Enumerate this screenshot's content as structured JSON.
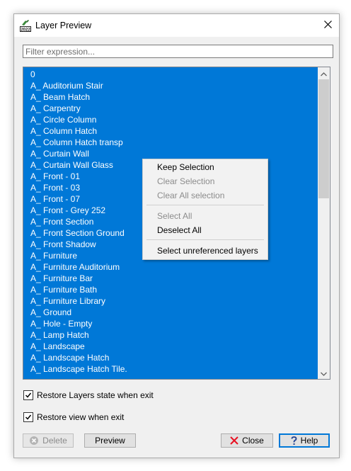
{
  "window": {
    "title": "Layer Preview"
  },
  "filter": {
    "placeholder": "Filter expression...",
    "value": ""
  },
  "layers": [
    "0",
    "A_ Auditorium Stair",
    "A_ Beam Hatch",
    "A_ Carpentry",
    "A_ Circle Column",
    "A_ Column Hatch",
    "A_ Column Hatch transp",
    "A_ Curtain Wall",
    "A_ Curtain Wall Glass",
    "A_ Front - 01",
    "A_ Front - 03",
    "A_ Front - 07",
    "A_ Front - Grey 252",
    "A_ Front Section",
    "A_ Front Section Ground",
    "A_ Front Shadow",
    "A_ Furniture",
    "A_ Furniture Auditorium",
    "A_ Furniture Bar",
    "A_ Furniture Bath",
    "A_ Furniture Library",
    "A_ Ground",
    "A_ Hole - Empty",
    "A_ Lamp Hatch",
    "A_ Landscape",
    "A_ Landscape Hatch",
    "A_ Landscape Hatch Tile."
  ],
  "context_menu": {
    "keep_selection": "Keep Selection",
    "clear_selection": "Clear Selection",
    "clear_all_selection": "Clear All selection",
    "select_all": "Select All",
    "deselect_all": "Deselect All",
    "select_unreferenced": "Select unreferenced layers"
  },
  "options": {
    "restore_layers_state": {
      "label": "Restore Layers state when exit",
      "checked": true
    },
    "restore_view": {
      "label": "Restore view when exit",
      "checked": true
    }
  },
  "buttons": {
    "delete": "Delete",
    "preview": "Preview",
    "close": "Close",
    "help": "Help"
  },
  "colors": {
    "selection": "#0078d7",
    "close_icon": "#e81123",
    "help_icon": "#1f3f8f"
  },
  "icons": {
    "app": "drawing-app-icon",
    "window_close": "close-icon",
    "delete": "delete-circle-x-icon",
    "close": "red-x-icon",
    "help": "question-mark-icon"
  }
}
